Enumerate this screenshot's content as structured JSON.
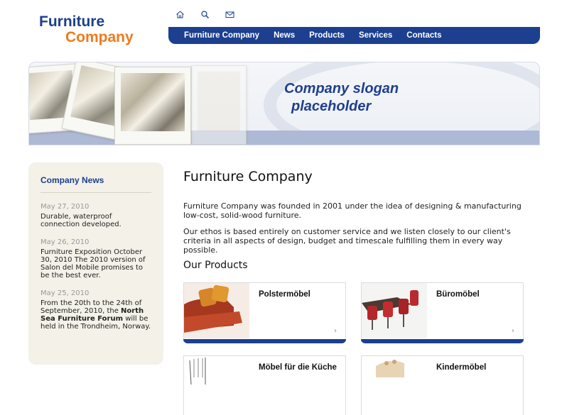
{
  "logo": {
    "line1": "Furniture",
    "line2": "Company"
  },
  "top_icons": [
    "home-icon",
    "search-icon",
    "mail-icon"
  ],
  "nav": [
    "Furniture Company",
    "News",
    "Products",
    "Services",
    "Contacts"
  ],
  "banner": {
    "slogan_line1": "Company slogan",
    "slogan_line2": "placeholder"
  },
  "sidebar": {
    "title": "Company News",
    "items": [
      {
        "date": "May 27, 2010",
        "text": "Durable, waterproof connection developed."
      },
      {
        "date": "May 26, 2010",
        "text": "Furniture Exposition October 30, 2010 The 2010 version of Salon del Mobile promises to be the best ever."
      },
      {
        "date": "May 25, 2010",
        "text_before": "From the 20th to the 24th of September, 2010, the ",
        "text_bold": "North Sea Furniture Forum",
        "text_after": " will be held in the Trondheim, Norway."
      }
    ]
  },
  "main": {
    "title": "Furniture Company",
    "p1": "Furniture Company was founded in 2001 under the idea of designing & manufacturing low-cost, solid-wood furniture.",
    "p2": "Our ethos is based entirely on customer service and we listen closely to our client's criteria in all aspects of design, budget and timescale fulfilling them in every way possible.",
    "products_title": "Our Products",
    "products": [
      "Polstermöbel",
      "Büromöbel",
      "Möbel für die Küche",
      "Kindermöbel"
    ],
    "arrow": "›"
  },
  "colors": {
    "brand_blue": "#1c3f8f",
    "brand_orange": "#ee7a1f"
  }
}
